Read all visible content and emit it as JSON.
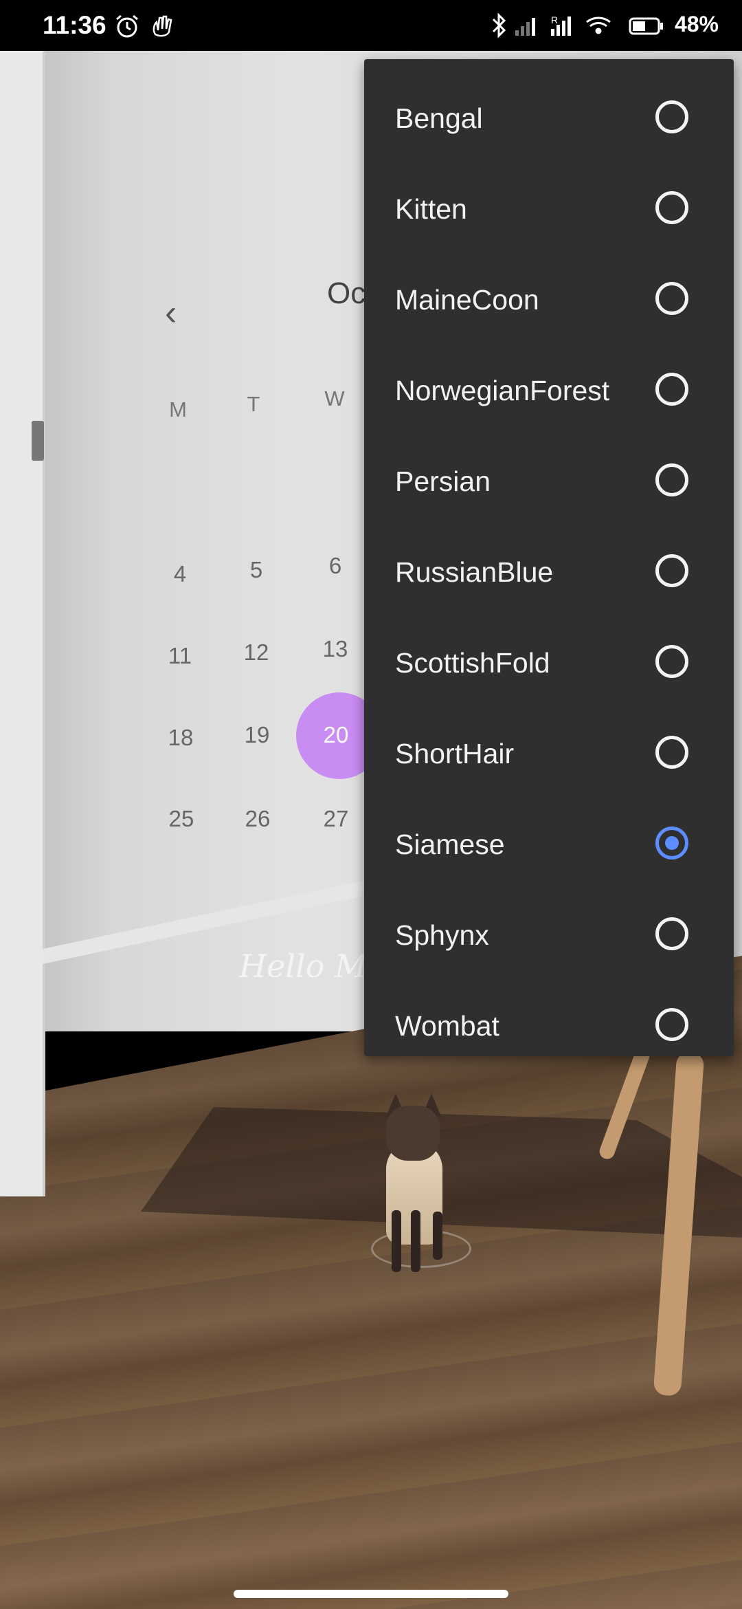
{
  "status_bar": {
    "time": "11:36",
    "battery": "48%",
    "icons": [
      "alarm-icon",
      "gesture-icon",
      "bluetooth-icon",
      "signal-icon",
      "signal-roaming-icon",
      "wifi-icon",
      "battery-icon"
    ]
  },
  "calendar": {
    "month_partial": "Oc",
    "weekday_headers": [
      "M",
      "T",
      "W"
    ],
    "rows": [
      [
        "4",
        "5",
        "6"
      ],
      [
        "11",
        "12",
        "13"
      ],
      [
        "18",
        "19",
        "20"
      ],
      [
        "25",
        "26",
        "27"
      ]
    ],
    "selected_day": "20",
    "accent_color": "#c98cf2"
  },
  "ar_text": "Hello Ma",
  "dropdown": {
    "options": [
      {
        "label": "Bengal",
        "selected": false
      },
      {
        "label": "Kitten",
        "selected": false
      },
      {
        "label": "MaineCoon",
        "selected": false
      },
      {
        "label": "NorwegianForest",
        "selected": false
      },
      {
        "label": "Persian",
        "selected": false
      },
      {
        "label": "RussianBlue",
        "selected": false
      },
      {
        "label": "ScottishFold",
        "selected": false
      },
      {
        "label": "ShortHair",
        "selected": false
      },
      {
        "label": "Siamese",
        "selected": true
      },
      {
        "label": "Sphynx",
        "selected": false
      },
      {
        "label": "Wombat",
        "selected": false
      }
    ],
    "selected_value": "Siamese",
    "selected_color": "#5b8dff"
  }
}
